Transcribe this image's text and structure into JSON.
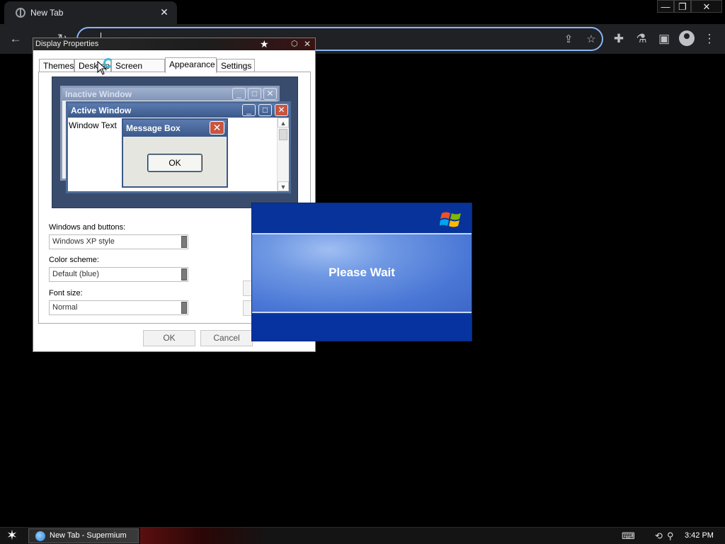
{
  "browser": {
    "tab_title": "New Tab",
    "tab_close": "✕",
    "window_controls": {
      "minimize": "—",
      "restore": "❐",
      "close": "✕"
    },
    "nav": {
      "back": "←",
      "forward": "→",
      "reload": "↻"
    },
    "omnibox_icons": {
      "share": "⇪",
      "bookmark": "☆"
    },
    "toolbar_icons": {
      "extensions": "✚",
      "labs": "⚗",
      "sidepanel": "▣",
      "menu": "⋮"
    }
  },
  "dialog": {
    "title": "Display Properties",
    "title_icons": {
      "star": "★",
      "pin": "⬡",
      "close": "✕"
    },
    "tabs": [
      {
        "label": "Themes"
      },
      {
        "label": "Desktop"
      },
      {
        "label": "Screen Saver"
      },
      {
        "label": "Appearance"
      },
      {
        "label": "Settings"
      }
    ],
    "preview": {
      "inactive_title": "Inactive Window",
      "active_title": "Active Window",
      "window_text": "Window Text",
      "message_title": "Message Box",
      "message_ok": "OK",
      "caption_buttons": {
        "minimize": "_",
        "maximize": "□",
        "close": "✕"
      },
      "scroll": {
        "up": "▲",
        "down": "▼"
      }
    },
    "fields": {
      "windows_buttons_label": "Windows and buttons:",
      "windows_buttons_value": "Windows XP style",
      "color_scheme_label": "Color scheme:",
      "color_scheme_value": "Default (blue)",
      "font_size_label": "Font size:",
      "font_size_value": "Normal"
    },
    "buttons": {
      "ok": "OK",
      "cancel": "Cancel"
    }
  },
  "please_wait": {
    "message": "Please Wait"
  },
  "taskbar": {
    "start_icon": "✶",
    "task_label": "New Tab - Supermium",
    "tray": {
      "keyboard": "⌨",
      "network": "⟲",
      "search": "⚲"
    },
    "clock": "3:42 PM"
  },
  "colors": {
    "xp_blue": "#0b3aa0",
    "active_caption": "#3b5889",
    "omnibox_focus": "#8ab4f8"
  }
}
